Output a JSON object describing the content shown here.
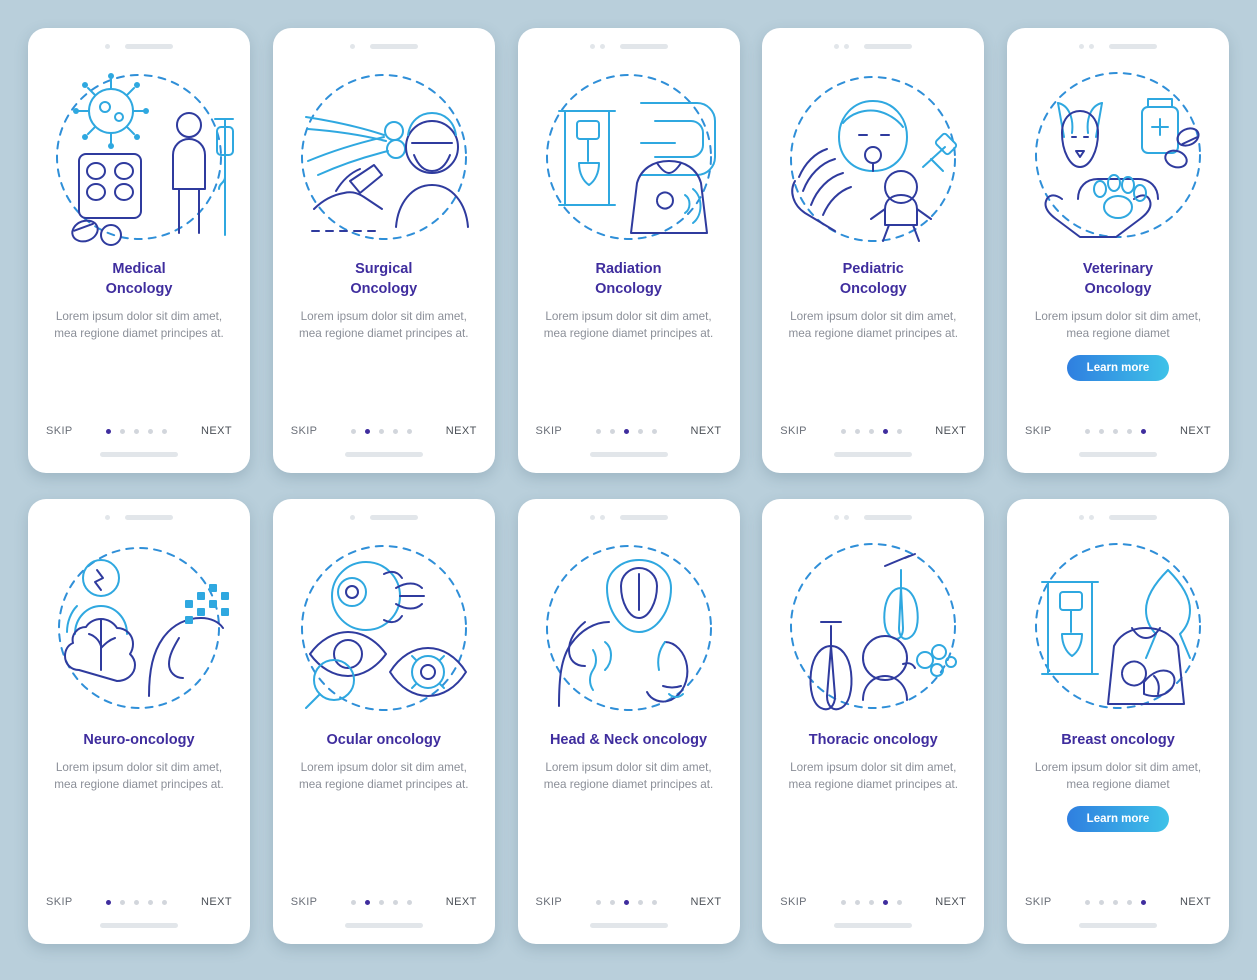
{
  "meta": {
    "background_color": "#b9cfdb",
    "title_color": "#3f2d9e",
    "desc_color": "#8b8f98",
    "accent_gradient_from": "#2f7fe0",
    "accent_gradient_to": "#3ec2e8",
    "line_color_dark": "#2f3b9e",
    "line_color_light": "#2fa8e0"
  },
  "common": {
    "skip_label": "SKIP",
    "next_label": "NEXT",
    "cta_label": "Learn more",
    "dot_count": 5,
    "description": "Lorem ipsum dolor sit dim amet, mea regione diamet principes at."
  },
  "screens": [
    {
      "id": "medical-oncology",
      "title": "Medical Oncology",
      "title_lines": [
        "Medical",
        "Oncology"
      ],
      "description": "Lorem ipsum dolor sit dim amet, mea regione diamet principes at.",
      "active_dot": 0,
      "has_cta": false,
      "icon": "virus-pills-patient-icon",
      "status_dots": 1
    },
    {
      "id": "surgical-oncology",
      "title": "Surgical Oncology",
      "title_lines": [
        "Surgical",
        "Oncology"
      ],
      "description": "Lorem ipsum dolor sit dim amet, mea regione diamet principes at.",
      "active_dot": 1,
      "has_cta": false,
      "icon": "scalpel-surgeon-icon",
      "status_dots": 1
    },
    {
      "id": "radiation-oncology",
      "title": "Radiation Oncology",
      "title_lines": [
        "Radiation",
        "Oncology"
      ],
      "description": "Lorem ipsum dolor sit dim amet, mea regione diamet principes at.",
      "active_dot": 2,
      "has_cta": false,
      "icon": "radiation-scanner-icon",
      "status_dots": 2
    },
    {
      "id": "pediatric-oncology",
      "title": "Pediatric Oncology",
      "title_lines": [
        "Pediatric",
        "Oncology"
      ],
      "description": "Lorem ipsum dolor sit dim amet, mea regione diamet principes at.",
      "active_dot": 3,
      "has_cta": false,
      "icon": "child-care-icon",
      "status_dots": 2
    },
    {
      "id": "veterinary-oncology",
      "title": "Veterinary Oncology",
      "title_lines": [
        "Veterinary",
        "Oncology"
      ],
      "description": "Lorem ipsum dolor sit dim amet, mea regione diamet",
      "active_dot": 4,
      "has_cta": true,
      "cta_label": "Learn more",
      "icon": "dog-paw-medicine-icon",
      "status_dots": 2
    },
    {
      "id": "neuro-oncology",
      "title": "Neuro-oncology",
      "title_lines": [
        "Neuro-oncology"
      ],
      "description": "Lorem ipsum dolor sit dim amet, mea regione diamet principes at.",
      "active_dot": 0,
      "has_cta": false,
      "icon": "brain-head-icon",
      "status_dots": 1
    },
    {
      "id": "ocular-oncology",
      "title": "Ocular oncology",
      "title_lines": [
        "Ocular oncology"
      ],
      "description": "Lorem ipsum dolor sit dim amet, mea regione diamet principes at.",
      "active_dot": 1,
      "has_cta": false,
      "icon": "eye-exam-icon",
      "status_dots": 1
    },
    {
      "id": "head-neck-oncology",
      "title": "Head & Neck oncology",
      "title_lines": [
        "Head & Neck oncology"
      ],
      "description": "Lorem ipsum dolor sit dim amet, mea regione diamet principes at.",
      "active_dot": 2,
      "has_cta": false,
      "icon": "head-neck-nose-icon",
      "status_dots": 2
    },
    {
      "id": "thoracic-oncology",
      "title": "Thoracic oncology",
      "title_lines": [
        "Thoracic oncology"
      ],
      "description": "Lorem ipsum dolor sit dim amet, mea regione diamet principes at.",
      "active_dot": 3,
      "has_cta": false,
      "icon": "lungs-smoking-icon",
      "status_dots": 2
    },
    {
      "id": "breast-oncology",
      "title": "Breast oncology",
      "title_lines": [
        "Breast oncology"
      ],
      "description": "Lorem ipsum dolor sit dim amet, mea regione diamet",
      "active_dot": 4,
      "has_cta": true,
      "cta_label": "Learn more",
      "icon": "breast-ribbon-mammogram-icon",
      "status_dots": 2
    }
  ]
}
